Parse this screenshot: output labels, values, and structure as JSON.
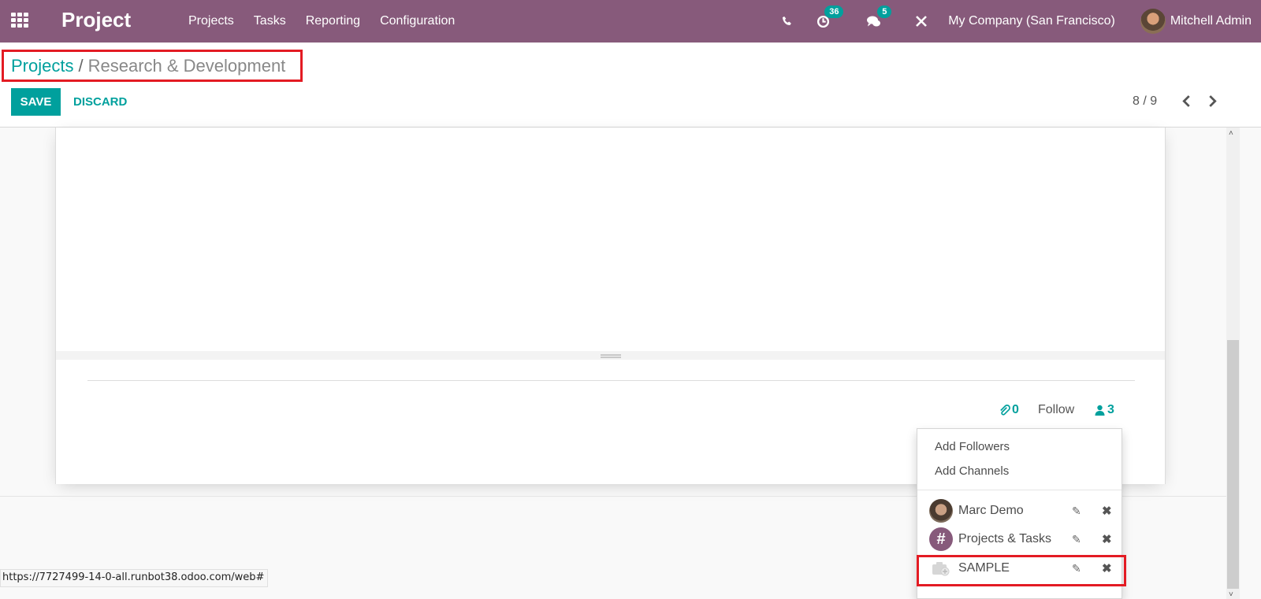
{
  "navbar": {
    "app_name": "Project",
    "menu": [
      "Projects",
      "Tasks",
      "Reporting",
      "Configuration"
    ],
    "activity_count": "36",
    "message_count": "5",
    "company": "My Company (San Francisco)",
    "user": "Mitchell Admin"
  },
  "control_panel": {
    "breadcrumb_parent": "Projects",
    "breadcrumb_separator": "/",
    "breadcrumb_current": "Research & Development",
    "save_label": "SAVE",
    "discard_label": "DISCARD",
    "pager": "8 / 9"
  },
  "chatter": {
    "attachment_count": "0",
    "follow_label": "Follow",
    "follower_count": "3"
  },
  "followers_dropdown": {
    "add_followers": "Add Followers",
    "add_channels": "Add Channels",
    "followers": [
      {
        "name": "Marc Demo",
        "type": "user"
      },
      {
        "name": "Projects & Tasks",
        "type": "channel"
      },
      {
        "name": "SAMPLE",
        "type": "partner"
      }
    ]
  },
  "status_bar": {
    "url": "https://7727499-14-0-all.runbot38.odoo.com/web#"
  },
  "colors": {
    "brand": "#875a7b",
    "accent": "#00a09d",
    "highlight": "#e31b23"
  }
}
